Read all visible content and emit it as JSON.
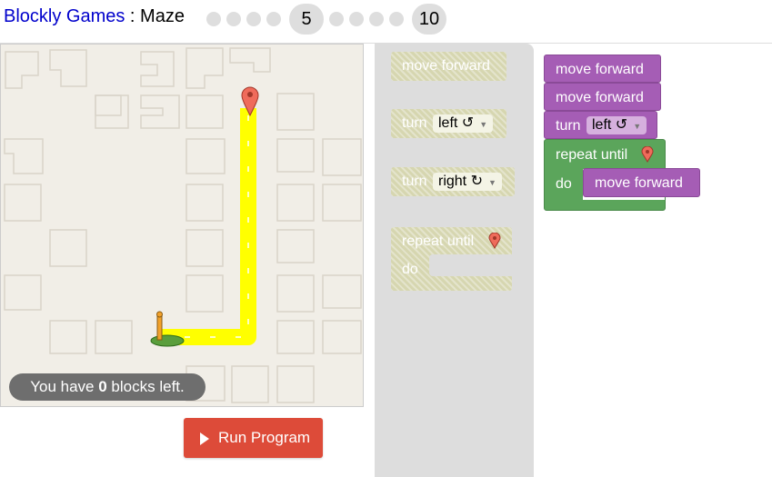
{
  "header": {
    "app_link": "Blockly Games",
    "separator": " : ",
    "game": "Maze",
    "levels": [
      "5",
      "10"
    ]
  },
  "maze": {
    "blocks_left_prefix": "You have ",
    "blocks_left_count": "0",
    "blocks_left_suffix": " blocks left.",
    "path_color": "#ffff00",
    "marker_color": "#ef6b5b"
  },
  "run_button": {
    "label": "Run Program"
  },
  "toolbox": {
    "move_forward": "move forward",
    "turn_label": "turn",
    "turn_left": "left ↺",
    "turn_right": "right ↻",
    "repeat_until": "repeat until",
    "do_label": "do"
  },
  "workspace": {
    "block1": "move forward",
    "block2": "move forward",
    "turn_label": "turn",
    "turn_value": "left ↺",
    "repeat_until": "repeat until",
    "do_label": "do",
    "inner": "move forward"
  },
  "colors": {
    "purple": "#a55db5",
    "green": "#5ba55b",
    "run_button": "#dd4b39"
  }
}
